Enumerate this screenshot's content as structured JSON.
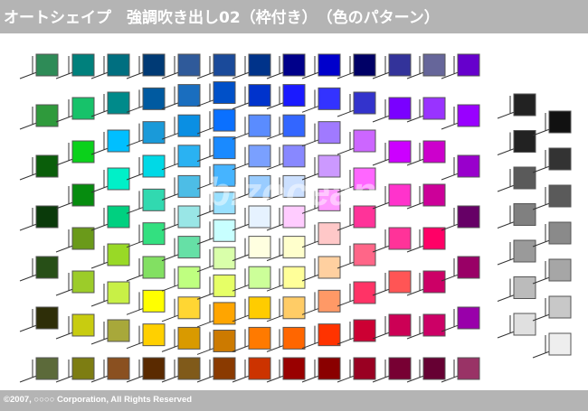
{
  "header": {
    "title": "オートシェイプ　強調吹き出し02（枠付き）　（色のパターン）"
  },
  "footer": {
    "copyright": "©2007, ○○○○ Corporation, All Rights Reserved"
  },
  "watermark": {
    "text": "bizocean"
  },
  "swatch_style": {
    "border": "#555555",
    "leader": "#333333"
  },
  "columns": [
    [
      "#2e8b57",
      "#2f9a3c",
      "#0a5e0a",
      "#0a3a0a",
      "#274f17",
      "#2e2e08",
      "#5c6a3a"
    ],
    [
      "#00807c",
      "#17c26a",
      "#0bd11b",
      "#068c0f",
      "#6a9a1a",
      "#9ccc29",
      "#c8cc10",
      "#7d7d12"
    ],
    [
      "#006f80",
      "#008a8a",
      "#00bfff",
      "#00f0c8",
      "#00d080",
      "#99d926",
      "#c8f046",
      "#a8a83a",
      "#8a5020"
    ],
    [
      "#003a75",
      "#005aa0",
      "#1a9ad9",
      "#00d9e6",
      "#31d9b0",
      "#33e080",
      "#82e062",
      "#ffff00",
      "#ffd000",
      "#5a2a00"
    ],
    [
      "#2f5a9a",
      "#1a6ebf",
      "#0a8fe3",
      "#2ab2f2",
      "#4dbde6",
      "#99e6e6",
      "#66e0a6",
      "#bfff80",
      "#ffd633",
      "#d99a00",
      "#805a1a"
    ],
    [
      "#1a4a9a",
      "#0050c8",
      "#0a70ff",
      "#1a8aff",
      "#46b4ff",
      "#99e0ff",
      "#c8ffff",
      "#d9ffaa",
      "#e6ff66",
      "#ffa500",
      "#cc7a00",
      "#8a3a00"
    ],
    [
      "#00338a",
      "#0033cc",
      "#5a8cff",
      "#7aa0ff",
      "#99ccff",
      "#e6f2ff",
      "#ffffe0",
      "#ccff99",
      "#ffcc00",
      "#ff7a00",
      "#cc3300"
    ],
    [
      "#00008a",
      "#1a1aff",
      "#3366ff",
      "#8888ff",
      "#cce0ff",
      "#ffccff",
      "#ffffcc",
      "#ffff99",
      "#ffcc66",
      "#ff6600",
      "#990000"
    ],
    [
      "#0000cc",
      "#3333ff",
      "#a07aff",
      "#cc99ff",
      "#ff99ff",
      "#ffc8c8",
      "#ffd0a0",
      "#ff9966",
      "#ff3300",
      "#8a0000"
    ],
    [
      "#000066",
      "#3333cc",
      "#cc66ff",
      "#ff66ff",
      "#ff3399",
      "#ff6688",
      "#ff3366",
      "#cc0033",
      "#990022"
    ],
    [
      "#33339a",
      "#7a00ff",
      "#cc00ff",
      "#ff33cc",
      "#ff3399",
      "#ff5555",
      "#cc0055",
      "#770033"
    ],
    [
      "#66669a",
      "#9933ff",
      "#cc00cc",
      "#cc0099",
      "#ff0066",
      "#cc0066",
      "#cc0066",
      "#660033"
    ],
    [
      "#6600cc",
      "#9900ff",
      "#9900cc",
      "#660066",
      "#990066",
      "#9900aa",
      "#993366"
    ],
    [
      "#222222",
      "#222222",
      "#5a5a5a",
      "#808080",
      "#9a9a9a",
      "#bbbbbb",
      "#e0e0e0"
    ],
    [
      "#111111",
      "#333333",
      "#5a5a5a",
      "#8a8a8a",
      "#a6a6a6",
      "#c8c8c8",
      "#eeeeee"
    ]
  ]
}
